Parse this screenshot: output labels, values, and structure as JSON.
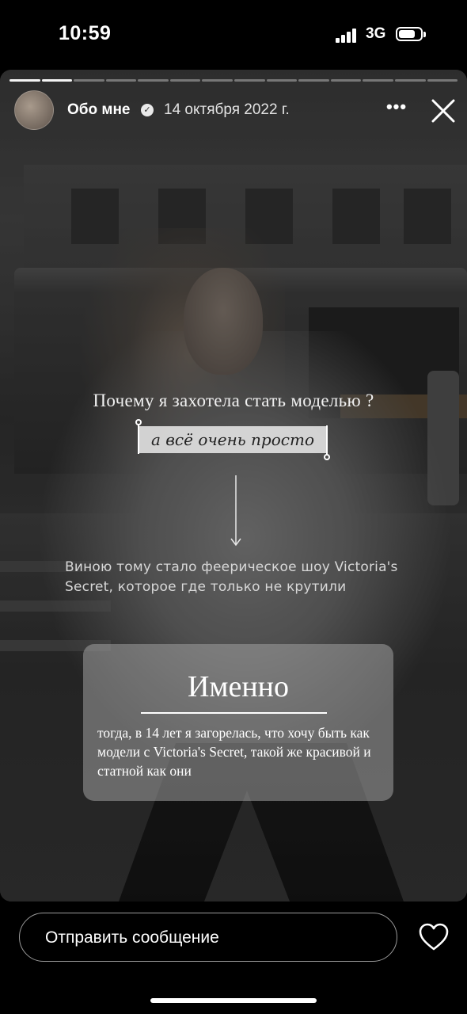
{
  "status_bar": {
    "time": "10:59",
    "network": "3G",
    "battery_level": 0.75
  },
  "story": {
    "progress": {
      "segments": 14,
      "current": 2
    },
    "header": {
      "username": "Обо мне",
      "verified": true,
      "date": "14 октября 2022 г."
    },
    "question": "Почему я захотела стать моделью ?",
    "tag": "а всё очень просто",
    "reason": "Виною тому стало феерическое шоу Victoria's Secret, которое где только не крутили",
    "card": {
      "title": "Именно",
      "text": "тогда, в 14 лет я загорелась, что хочу быть как модели с Victoria's Secret, такой же красивой и статной как они"
    }
  },
  "reply": {
    "placeholder": "Отправить сообщение"
  },
  "icons": {
    "more": "more-icon",
    "close": "close-icon",
    "verified": "verified-badge-icon",
    "like": "heart-icon",
    "arrow": "arrow-down-icon"
  }
}
